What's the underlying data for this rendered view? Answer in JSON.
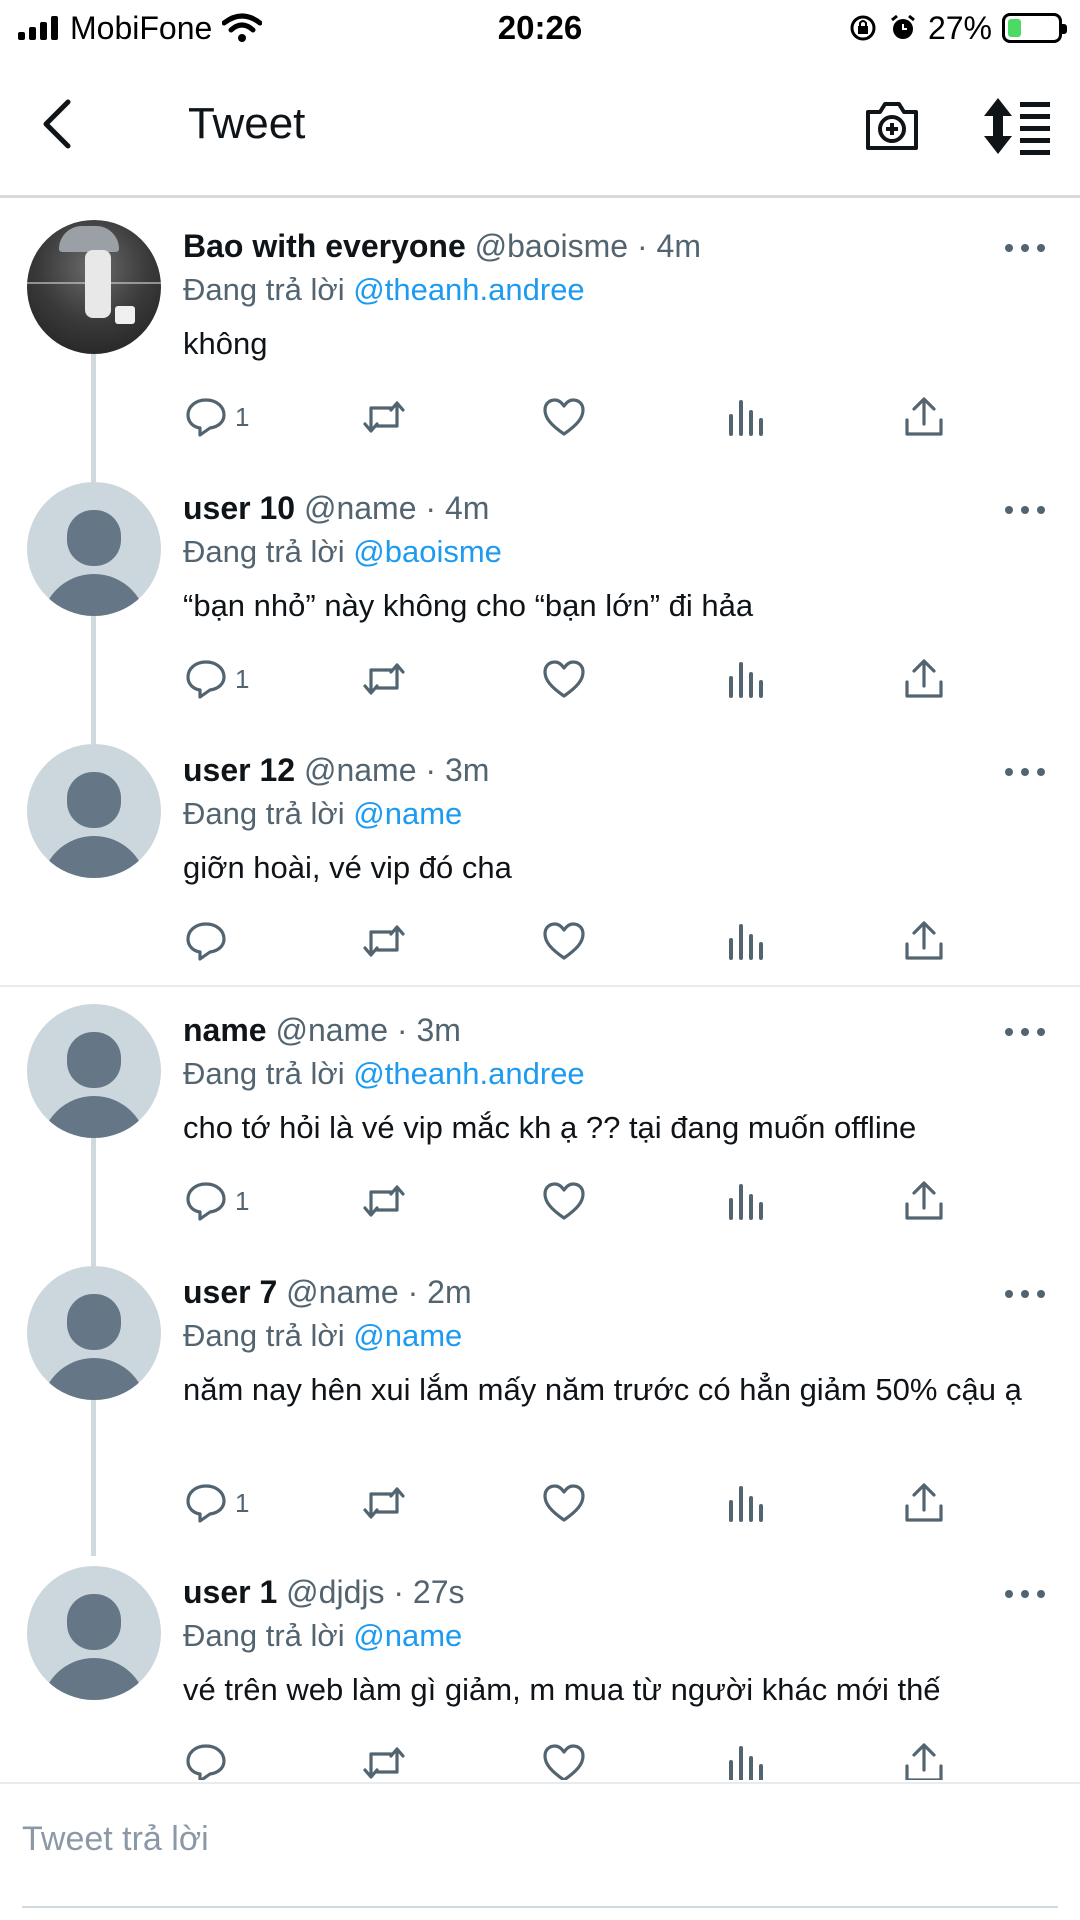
{
  "status_bar": {
    "carrier": "MobiFone",
    "time": "20:26",
    "battery": "27%",
    "battery_level": 0.27
  },
  "header": {
    "title": "Tweet",
    "icons": [
      "back-chevron-icon",
      "camera-plus-icon",
      "sort-icon"
    ]
  },
  "reply_prefix": "Đang trả lời",
  "tweets": [
    {
      "name": "Bao with everyone",
      "handle": "@baoisme",
      "time": "4m",
      "replying_to": "@theanh.andree",
      "text": "không",
      "replies": "1"
    },
    {
      "name": "user 10",
      "handle": "@name",
      "time": "4m",
      "replying_to": "@baoisme",
      "text": "“bạn nhỏ” này không cho “bạn lớn” đi hảa",
      "replies": "1"
    },
    {
      "name": "user 12",
      "handle": "@name",
      "time": "3m",
      "replying_to": "@name",
      "text": "giỡn hoài, vé vip đó cha",
      "replies": ""
    },
    {
      "name": "name",
      "handle": "@name",
      "time": "3m",
      "replying_to": "@theanh.andree",
      "text": "cho tớ hỏi là vé vip mắc kh ạ ?? tại đang muốn offline",
      "replies": "1"
    },
    {
      "name": "user 7",
      "handle": "@name",
      "time": "2m",
      "replying_to": "@name",
      "text": "năm nay hên xui lắm mấy năm trước có hẳn giảm 50% cậu ạ",
      "replies": "1"
    },
    {
      "name": "user 1",
      "handle": "@djdjs",
      "time": "27s",
      "replying_to": "@name",
      "text": "vé trên web làm gì giảm, m mua từ người khác mới thế",
      "replies": ""
    }
  ],
  "composer": {
    "placeholder": "Tweet trả lời"
  },
  "colors": {
    "link": "#1d9bf0",
    "secondary_text": "#536471",
    "primary_text": "#0f1419",
    "avatar_bg": "#ccd6dd",
    "avatar_fg": "#657786"
  }
}
